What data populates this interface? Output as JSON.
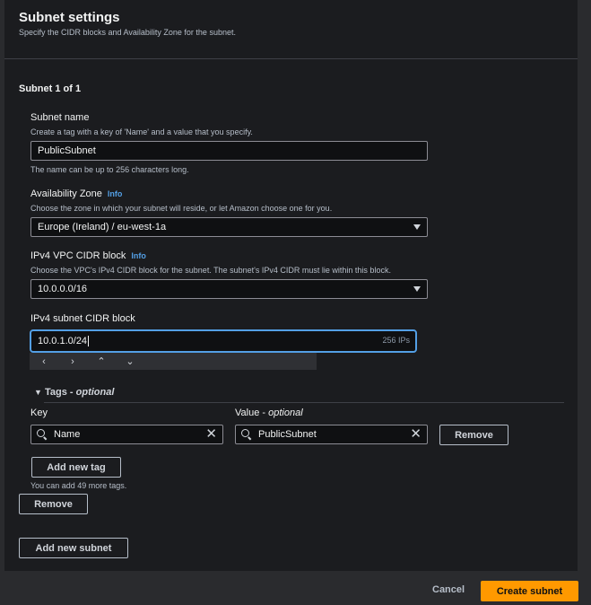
{
  "header": {
    "title": "Subnet settings",
    "subtitle": "Specify the CIDR blocks and Availability Zone for the subnet."
  },
  "subnet": {
    "heading": "Subnet 1 of 1",
    "name": {
      "label": "Subnet name",
      "description": "Create a tag with a key of 'Name' and a value that you specify.",
      "value": "PublicSubnet",
      "hint": "The name can be up to 256 characters long."
    },
    "az": {
      "label": "Availability Zone",
      "info": "Info",
      "description": "Choose the zone in which your subnet will reside, or let Amazon choose one for you.",
      "value": "Europe (Ireland) / eu-west-1a"
    },
    "vpc_cidr": {
      "label": "IPv4 VPC CIDR block",
      "info": "Info",
      "description": "Choose the VPC's IPv4 CIDR block for the subnet. The subnet's IPv4 CIDR must lie within this block.",
      "value": "10.0.0.0/16"
    },
    "subnet_cidr": {
      "label": "IPv4 subnet CIDR block",
      "value": "10.0.1.0/24",
      "ips": "256 IPs",
      "toolbar": [
        "‹",
        "›",
        "⌃",
        "⌄"
      ]
    },
    "tags": {
      "heading": "Tags",
      "optional": "optional",
      "key_label": "Key",
      "value_label": "Value",
      "value_optional": "optional",
      "key": "Name",
      "value": "PublicSubnet",
      "remove_label": "Remove",
      "add_label": "Add new tag",
      "limit_text": "You can add 49 more tags."
    },
    "remove_label": "Remove"
  },
  "add_subnet_label": "Add new subnet",
  "footer": {
    "cancel_label": "Cancel",
    "create_label": "Create subnet"
  },
  "colors": {
    "accent": "#ff9900",
    "link": "#539fe5",
    "focus": "#539fe5"
  }
}
